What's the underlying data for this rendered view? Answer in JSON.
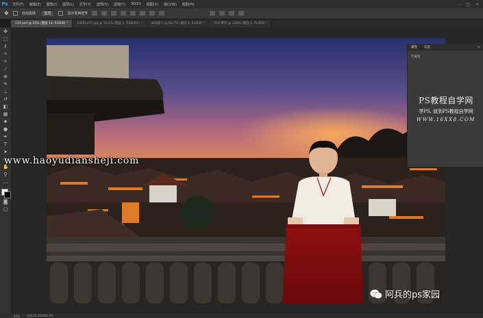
{
  "app": {
    "logo": "Ps"
  },
  "menu": [
    "文件(F)",
    "编辑(E)",
    "图像(I)",
    "图层(L)",
    "文字(Y)",
    "选择(S)",
    "滤镜(T)",
    "3D(D)",
    "视图(V)",
    "窗口(W)",
    "帮助(H)"
  ],
  "window_controls": [
    "–",
    "□",
    "×"
  ],
  "options": {
    "auto_select": "自动选择:",
    "layer_select": "图层",
    "show_transform": "显示变换控件"
  },
  "tabs": [
    {
      "label": "519.psd @ 25% (图层 14, RGB/8) *",
      "active": true
    },
    {
      "label": "10691437.jpg @ 33.2% (图层 1, RGB/8#) *",
      "active": false
    },
    {
      "label": "未标题-1 @ 66.7% (图层 1, RGB/8) *",
      "active": false
    },
    {
      "label": "519 拷贝 @ 100% (图层 1, RGB/8) *",
      "active": false
    }
  ],
  "panel": {
    "tabs": [
      "属性",
      "信息"
    ],
    "body": "无属性"
  },
  "watermark_panel": {
    "line1": "PS教程自学网",
    "line2": "学PS, 就到PS教程自学网",
    "line3": "WWW.16XX8.COM"
  },
  "watermark_left": "www.haoyudiansheji.com",
  "watermark_bottom": "阿兵的ps家园",
  "status": {
    "zoom": "25%",
    "doc": "文档:55.0M/950.7M"
  },
  "colors": {
    "menubar": "#2d2d2d",
    "optbar": "#383838",
    "canvas_bg": "#262626",
    "accent": "#31a8ff"
  },
  "icons": [
    "move-icon",
    "marquee-icon",
    "lasso-icon",
    "magic-wand-icon",
    "crop-icon",
    "eyedropper-icon",
    "healing-icon",
    "brush-icon",
    "stamp-icon",
    "history-brush-icon",
    "eraser-icon",
    "gradient-icon",
    "blur-icon",
    "dodge-icon",
    "pen-icon",
    "type-icon",
    "path-select-icon",
    "shape-icon",
    "hand-icon",
    "zoom-icon",
    "more-icon",
    "swap-colors-icon",
    "quick-mask-icon",
    "screen-mode-icon"
  ]
}
